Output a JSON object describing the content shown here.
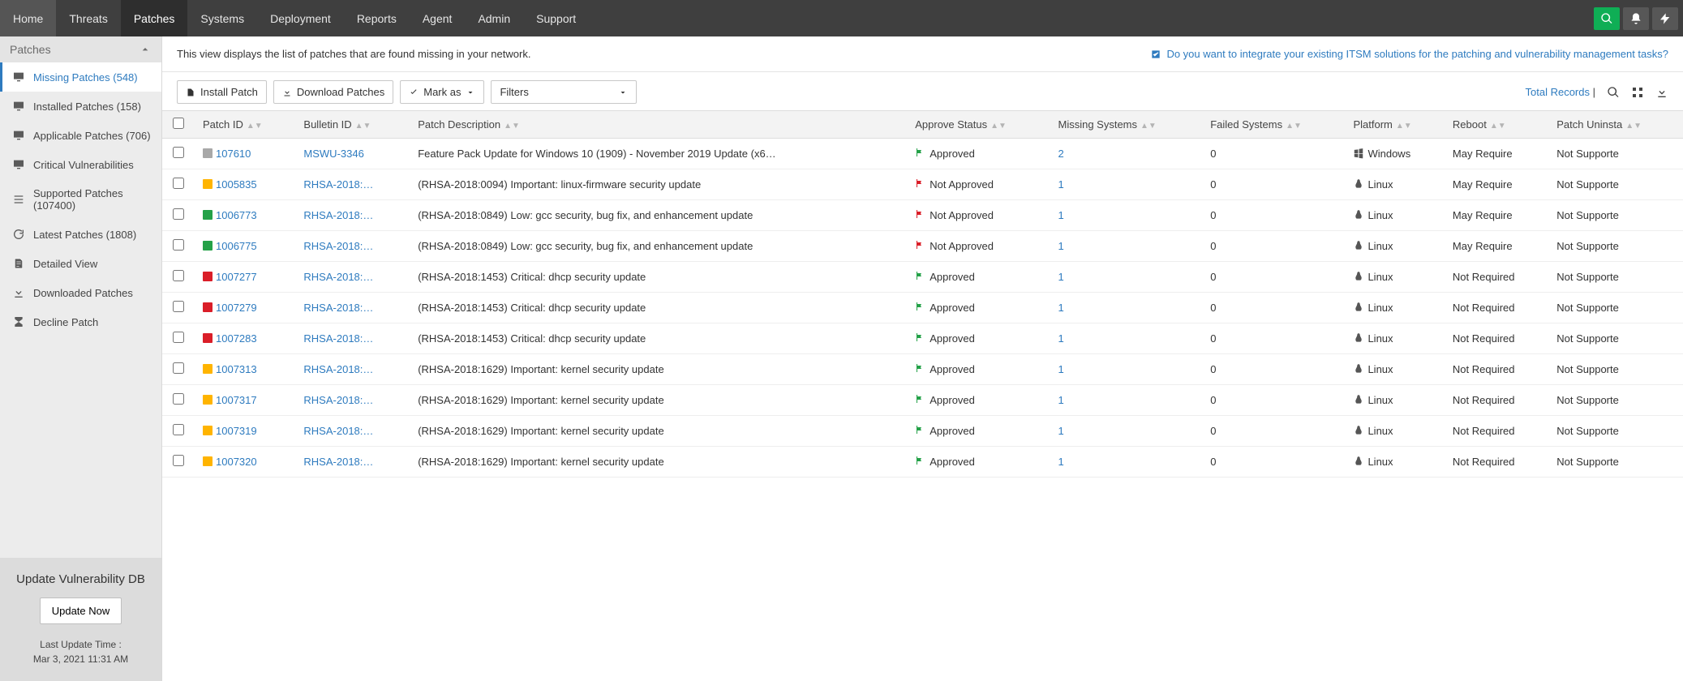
{
  "topnav": [
    "Home",
    "Threats",
    "Patches",
    "Systems",
    "Deployment",
    "Reports",
    "Agent",
    "Admin",
    "Support"
  ],
  "topnav_active": 2,
  "sidebar": {
    "header": "Patches",
    "items": [
      {
        "label": "Missing Patches (548)",
        "icon": "monitor"
      },
      {
        "label": "Installed Patches (158)",
        "icon": "monitor"
      },
      {
        "label": "Applicable Patches (706)",
        "icon": "monitor"
      },
      {
        "label": "Critical Vulnerabilities",
        "icon": "monitor"
      },
      {
        "label": "Supported Patches (107400)",
        "icon": "layers"
      },
      {
        "label": "Latest Patches (1808)",
        "icon": "refresh"
      },
      {
        "label": "Detailed View",
        "icon": "doc"
      },
      {
        "label": "Downloaded Patches",
        "icon": "download"
      },
      {
        "label": "Decline Patch",
        "icon": "decline"
      }
    ],
    "active": 0,
    "footer": {
      "title": "Update Vulnerability DB",
      "button": "Update Now",
      "line1": "Last Update Time :",
      "line2": "Mar 3, 2021 11:31 AM"
    }
  },
  "intro": "This view displays the list of patches that are found missing in your network.",
  "itsm_link": "Do you want to integrate your existing ITSM solutions for the patching and vulnerability management tasks?",
  "toolbar": {
    "install": "Install Patch",
    "download": "Download Patches",
    "markas": "Mark as",
    "filters": "Filters",
    "total_records": "Total Records"
  },
  "columns": [
    "",
    "Patch ID",
    "Bulletin ID",
    "Patch Description",
    "Approve Status",
    "Missing Systems",
    "Failed Systems",
    "Platform",
    "Reboot",
    "Patch Uninsta"
  ],
  "rows": [
    {
      "sev": "grey",
      "id": "107610",
      "bull": "MSWU-3346",
      "desc": "Feature Pack Update for Windows 10 (1909) - November 2019 Update (x6…",
      "approved": true,
      "miss": "2",
      "fail": "0",
      "plat": "Windows",
      "reboot": "May Require",
      "un": "Not Supporte"
    },
    {
      "sev": "yellow",
      "id": "1005835",
      "bull": "RHSA-2018:…",
      "desc": "(RHSA-2018:0094) Important: linux-firmware security update",
      "approved": false,
      "miss": "1",
      "fail": "0",
      "plat": "Linux",
      "reboot": "May Require",
      "un": "Not Supporte"
    },
    {
      "sev": "green",
      "id": "1006773",
      "bull": "RHSA-2018:…",
      "desc": "(RHSA-2018:0849) Low: gcc security, bug fix, and enhancement update",
      "approved": false,
      "miss": "1",
      "fail": "0",
      "plat": "Linux",
      "reboot": "May Require",
      "un": "Not Supporte"
    },
    {
      "sev": "green",
      "id": "1006775",
      "bull": "RHSA-2018:…",
      "desc": "(RHSA-2018:0849) Low: gcc security, bug fix, and enhancement update",
      "approved": false,
      "miss": "1",
      "fail": "0",
      "plat": "Linux",
      "reboot": "May Require",
      "un": "Not Supporte"
    },
    {
      "sev": "red",
      "id": "1007277",
      "bull": "RHSA-2018:…",
      "desc": "(RHSA-2018:1453) Critical: dhcp security update",
      "approved": true,
      "miss": "1",
      "fail": "0",
      "plat": "Linux",
      "reboot": "Not Required",
      "un": "Not Supporte"
    },
    {
      "sev": "red",
      "id": "1007279",
      "bull": "RHSA-2018:…",
      "desc": "(RHSA-2018:1453) Critical: dhcp security update",
      "approved": true,
      "miss": "1",
      "fail": "0",
      "plat": "Linux",
      "reboot": "Not Required",
      "un": "Not Supporte"
    },
    {
      "sev": "red",
      "id": "1007283",
      "bull": "RHSA-2018:…",
      "desc": "(RHSA-2018:1453) Critical: dhcp security update",
      "approved": true,
      "miss": "1",
      "fail": "0",
      "plat": "Linux",
      "reboot": "Not Required",
      "un": "Not Supporte"
    },
    {
      "sev": "yellow",
      "id": "1007313",
      "bull": "RHSA-2018:…",
      "desc": "(RHSA-2018:1629) Important: kernel security update",
      "approved": true,
      "miss": "1",
      "fail": "0",
      "plat": "Linux",
      "reboot": "Not Required",
      "un": "Not Supporte"
    },
    {
      "sev": "yellow",
      "id": "1007317",
      "bull": "RHSA-2018:…",
      "desc": "(RHSA-2018:1629) Important: kernel security update",
      "approved": true,
      "miss": "1",
      "fail": "0",
      "plat": "Linux",
      "reboot": "Not Required",
      "un": "Not Supporte"
    },
    {
      "sev": "yellow",
      "id": "1007319",
      "bull": "RHSA-2018:…",
      "desc": "(RHSA-2018:1629) Important: kernel security update",
      "approved": true,
      "miss": "1",
      "fail": "0",
      "plat": "Linux",
      "reboot": "Not Required",
      "un": "Not Supporte"
    },
    {
      "sev": "yellow",
      "id": "1007320",
      "bull": "RHSA-2018:…",
      "desc": "(RHSA-2018:1629) Important: kernel security update",
      "approved": true,
      "miss": "1",
      "fail": "0",
      "plat": "Linux",
      "reboot": "Not Required",
      "un": "Not Supporte"
    }
  ],
  "status_labels": {
    "approved": "Approved",
    "not_approved": "Not Approved"
  }
}
